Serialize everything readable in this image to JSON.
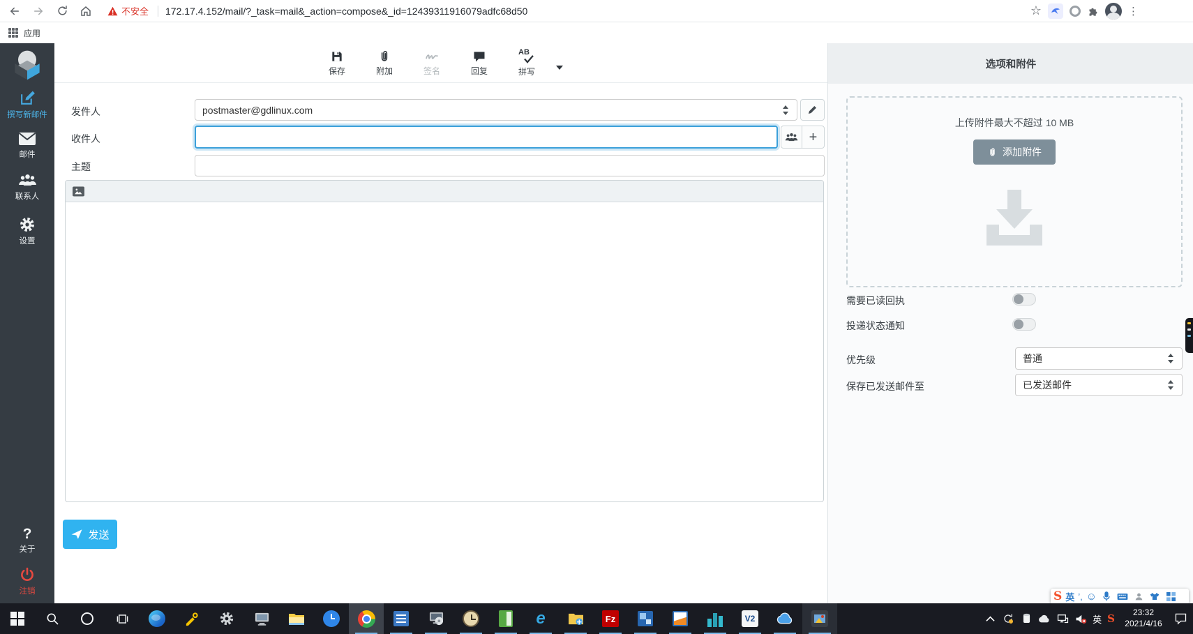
{
  "colors": {
    "accent": "#45a8df",
    "danger": "#e64940",
    "send_button": "#30b3f0",
    "taskbar": "#191b22",
    "sidebar": "#353c43"
  },
  "browser": {
    "not_secure_label": "不安全",
    "url": "172.17.4.152/mail/?_task=mail&_action=compose&_id=12439311916079adfc68d50",
    "apps_label": "应用"
  },
  "sidebar": {
    "items": [
      {
        "label": "撰写新邮件",
        "icon": "compose-icon",
        "active": true
      },
      {
        "label": "邮件",
        "icon": "mail-icon"
      },
      {
        "label": "联系人",
        "icon": "contacts-icon"
      },
      {
        "label": "设置",
        "icon": "settings-icon"
      }
    ],
    "help_glyph": "?",
    "about_label": "关于",
    "logout_label": "注销"
  },
  "toolbar": {
    "buttons": [
      {
        "label": "保存",
        "icon": "save-icon"
      },
      {
        "label": "附加",
        "icon": "attach-icon"
      },
      {
        "label": "签名",
        "icon": "signature-icon",
        "disabled": true
      },
      {
        "label": "回复",
        "icon": "responses-icon"
      },
      {
        "label": "拼写",
        "icon": "spellcheck-icon"
      }
    ],
    "spell_icon_text": "AB"
  },
  "compose": {
    "from_label": "发件人",
    "from_value": "postmaster@gdlinux.com",
    "to_label": "收件人",
    "to_value": "",
    "subject_label": "主题",
    "subject_value": "",
    "add_recipient_glyph": "+",
    "send_label": "发送"
  },
  "options_panel": {
    "title": "选项和附件",
    "upload_hint": "上传附件最大不超过 10 MB",
    "add_attachment_label": "添加附件",
    "read_receipt_label": "需要已读回执",
    "read_receipt_on": false,
    "dsn_label": "投递状态通知",
    "dsn_on": false,
    "priority_label": "优先级",
    "priority_value": "普通",
    "save_to_label": "保存已发送邮件至",
    "save_to_value": "已发送邮件"
  },
  "ime_bar": {
    "logo_text": "S",
    "mode": "英",
    "punct_glyph": "’,",
    "smiley_glyph": "☺"
  },
  "taskbar": {
    "apps": [
      "start",
      "search",
      "cortana",
      "task-view",
      "edge",
      "builder",
      "gear-app",
      "remote-app",
      "file-explorer",
      "alarms",
      "chrome",
      "document-app",
      "setup-app",
      "clock-app",
      "notes-app",
      "internet-explorer",
      "folder-app",
      "filezilla",
      "frames-app",
      "vm-app",
      "buildings-app",
      "vnc-viewer",
      "cloud-app",
      "photos-app"
    ],
    "filezilla_text": "Fz",
    "vnc_text": "V2",
    "ie_text": "e",
    "tray_lang": "英",
    "tray_ime_text": "S",
    "time": "23:32",
    "date": "2021/4/16"
  }
}
